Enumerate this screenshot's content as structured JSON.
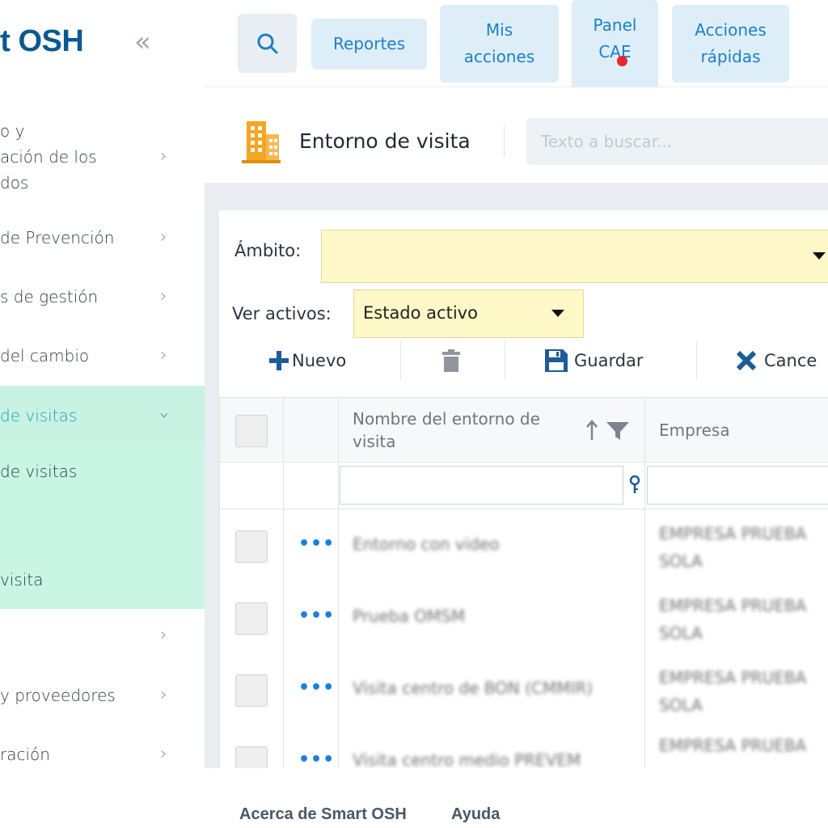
{
  "app": {
    "logo": "rt OSH",
    "collapse_icon": "double-chevron-left-icon"
  },
  "sidebar": {
    "items": [
      {
        "label": "o y\nación de los\ndos",
        "expanded": false
      },
      {
        "label": "de Prevención",
        "expanded": false
      },
      {
        "label": "s de gestión",
        "expanded": false
      },
      {
        "label": "del cambio",
        "expanded": false
      },
      {
        "label": "de visitas",
        "expanded": true
      },
      {
        "label": "",
        "expanded": false
      },
      {
        "label": "y proveedores",
        "expanded": false
      },
      {
        "label": "ración",
        "expanded": false
      }
    ],
    "subitems": [
      {
        "label": "de visitas"
      },
      {
        "label": "visita"
      }
    ]
  },
  "topnav": {
    "search_icon": "search-icon",
    "reportes": "Reportes",
    "mis_acciones": "Mis\nacciones",
    "panel_cae": "Panel\nCAE",
    "acciones_rapidas": "Acciones\nrápidas"
  },
  "page": {
    "title": "Entorno de visita",
    "icon": "building-icon",
    "search_placeholder": "Texto a buscar..."
  },
  "filters": {
    "ambito_label": "Ámbito:",
    "ambito_value": "",
    "ver_activos_label": "Ver activos:",
    "ver_activos_value": "Estado activo"
  },
  "toolbar": {
    "nuevo": "Nuevo",
    "guardar": "Guardar",
    "cancelar": "Cance"
  },
  "grid": {
    "columns": [
      "Nombre del entorno de\nvisita",
      "Empresa"
    ],
    "rows": [
      {
        "nombre": "Entorno con video",
        "empresa": "EMPRESA PRUEBA\nSOLA"
      },
      {
        "nombre": "Prueba OMSM",
        "empresa": "EMPRESA PRUEBA\nSOLA"
      },
      {
        "nombre": "Visita centro de BON (CMMIR)",
        "empresa": "EMPRESA PRUEBA\nSOLA"
      },
      {
        "nombre": "Visita centro medio PREVEM",
        "empresa": "EMPRESA PRUEBA"
      }
    ]
  },
  "footer": {
    "acerca": "Acerca de Smart OSH",
    "ayuda": "Ayuda"
  },
  "colors": {
    "brand": "#0a5a91",
    "accent": "#1e7fc6",
    "active_menu_bg": "#c8f2e1",
    "select_bg": "#fff8c8",
    "notification": "#e8262e"
  }
}
